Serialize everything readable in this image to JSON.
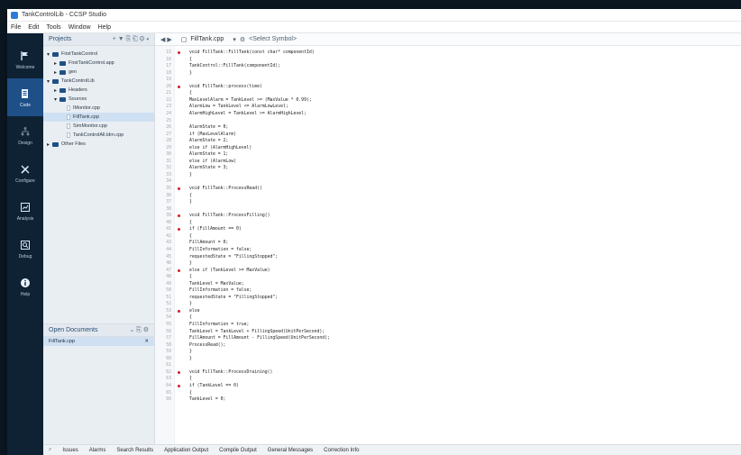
{
  "window": {
    "title": "TankControlLib - CCSP Studio",
    "menu": [
      "File",
      "Edit",
      "Tools",
      "Window",
      "Help"
    ]
  },
  "nav": {
    "items": [
      {
        "label": "Welcome",
        "icon": "flag-icon",
        "active": false
      },
      {
        "label": "Code",
        "icon": "file-icon",
        "active": true
      },
      {
        "label": "Design",
        "icon": "tree-icon",
        "active": false
      },
      {
        "label": "Configure",
        "icon": "tools-icon",
        "active": false
      },
      {
        "label": "Analysis",
        "icon": "chart-icon",
        "active": false
      },
      {
        "label": "Debug",
        "icon": "search-icon",
        "active": false
      },
      {
        "label": "Help",
        "icon": "info-icon",
        "active": false
      }
    ]
  },
  "projects": {
    "title": "Projects",
    "tools": "+ ▼ ⎘ ⎗ ⚙ ◂",
    "tree": [
      {
        "label": "FirstTankControl",
        "indent": 0,
        "type": "folder"
      },
      {
        "label": "FirstTankControl.app",
        "indent": 1,
        "type": "folder"
      },
      {
        "label": "gen",
        "indent": 1,
        "type": "folder"
      },
      {
        "label": "TankControlLib",
        "indent": 0,
        "type": "folder"
      },
      {
        "label": "Headers",
        "indent": 1,
        "type": "folder"
      },
      {
        "label": "Sources",
        "indent": 1,
        "type": "folder"
      },
      {
        "label": "IMonitor.cpp",
        "indent": 2,
        "type": "file"
      },
      {
        "label": "FillTank.cpp",
        "indent": 2,
        "type": "file",
        "selected": true
      },
      {
        "label": "SimMonitor.cpp",
        "indent": 2,
        "type": "file"
      },
      {
        "label": "TankControlAll.ldm.cpp",
        "indent": 2,
        "type": "file"
      },
      {
        "label": "Other Files",
        "indent": 0,
        "type": "folder"
      }
    ]
  },
  "open_documents": {
    "title": "Open Documents",
    "items": [
      "FillTank.cpp"
    ]
  },
  "editor": {
    "tab_label": "FillTank.cpp",
    "symbol_placeholder": "<Select Symbol>",
    "lines": [
      {
        "n": "15",
        "bp": true,
        "t": "void FillTank::FillTank(const char* componentId)"
      },
      {
        "n": "16",
        "t": "{"
      },
      {
        "n": "17",
        "t": "    TankControl::FillTank(componentId);"
      },
      {
        "n": "18",
        "t": "}"
      },
      {
        "n": "19",
        "t": ""
      },
      {
        "n": "20",
        "bp": true,
        "t": "void FillTank::process(time)"
      },
      {
        "n": "21",
        "t": "{"
      },
      {
        "n": "22",
        "t": "    MaxLevelAlarm = TankLevel >= (MaxValue * 0.99);"
      },
      {
        "n": "23",
        "t": "    AlarmLow = TankLevel <= AlarmLowLevel;"
      },
      {
        "n": "24",
        "t": "    AlarmHighLevel = TankLevel >= AlarmHighLevel;"
      },
      {
        "n": "25",
        "t": ""
      },
      {
        "n": "26",
        "t": "    AlarmState = 0;"
      },
      {
        "n": "27",
        "t": "    if (MaxLevelAlarm)"
      },
      {
        "n": "28",
        "t": "        AlarmState = 2;"
      },
      {
        "n": "29",
        "t": "    else if (AlarmHighLevel)"
      },
      {
        "n": "30",
        "t": "        AlarmState = 1;"
      },
      {
        "n": "31",
        "t": "    else if (AlarmLow)"
      },
      {
        "n": "32",
        "t": "        AlarmState = 3;"
      },
      {
        "n": "33",
        "t": "}"
      },
      {
        "n": "34",
        "t": ""
      },
      {
        "n": "35",
        "bp": true,
        "t": "void FillTank::ProcessRead()"
      },
      {
        "n": "36",
        "t": "{"
      },
      {
        "n": "37",
        "t": "}"
      },
      {
        "n": "38",
        "t": ""
      },
      {
        "n": "39",
        "bp": true,
        "t": "void FillTank::ProcessFilling()"
      },
      {
        "n": "40",
        "t": "{"
      },
      {
        "n": "41",
        "bp": true,
        "t": "    if (FillAmount == 0)"
      },
      {
        "n": "42",
        "t": "    {"
      },
      {
        "n": "43",
        "t": "        FillAmount = 0;"
      },
      {
        "n": "44",
        "t": "        FillInformation = false;"
      },
      {
        "n": "45",
        "t": "        requestedState = \"FillingStopped\";"
      },
      {
        "n": "46",
        "t": "    }"
      },
      {
        "n": "47",
        "bp": true,
        "t": "    else if (TankLevel >= MaxValue)"
      },
      {
        "n": "48",
        "t": "    {"
      },
      {
        "n": "49",
        "t": "        TankLevel = MaxValue;"
      },
      {
        "n": "50",
        "t": "        FillInformation = false;"
      },
      {
        "n": "51",
        "t": "        requestedState = \"FillingStopped\";"
      },
      {
        "n": "52",
        "t": "    }"
      },
      {
        "n": "53",
        "bp": true,
        "t": "    else"
      },
      {
        "n": "54",
        "t": "    {"
      },
      {
        "n": "55",
        "t": "        FillInformation = true;"
      },
      {
        "n": "56",
        "t": "        TankLevel = TankLevel + FillingSpeed(UnitPerSecond);"
      },
      {
        "n": "57",
        "t": "        FillAmount = FillAmount - FillingSpeed(UnitPerSecond);"
      },
      {
        "n": "58",
        "t": "        ProcessRead();"
      },
      {
        "n": "59",
        "t": "    }"
      },
      {
        "n": "60",
        "t": "}"
      },
      {
        "n": "61",
        "t": ""
      },
      {
        "n": "62",
        "bp": true,
        "t": "void FillTank::ProcessDraining()"
      },
      {
        "n": "63",
        "t": "{"
      },
      {
        "n": "64",
        "bp": true,
        "t": "    if (TankLevel == 0)"
      },
      {
        "n": "65",
        "t": "    {"
      },
      {
        "n": "66",
        "t": "        TankLevel = 0;"
      }
    ]
  },
  "bottom_tabs": [
    "Issues",
    "Alarms",
    "Search Results",
    "Application Output",
    "Compile Output",
    "General Messages",
    "Correction Info"
  ],
  "colors": {
    "nav_bg": "#0f2234",
    "nav_active": "#1e4f86",
    "keyword": "#c4171f",
    "function": "#b25b14",
    "string": "#c9a300"
  }
}
